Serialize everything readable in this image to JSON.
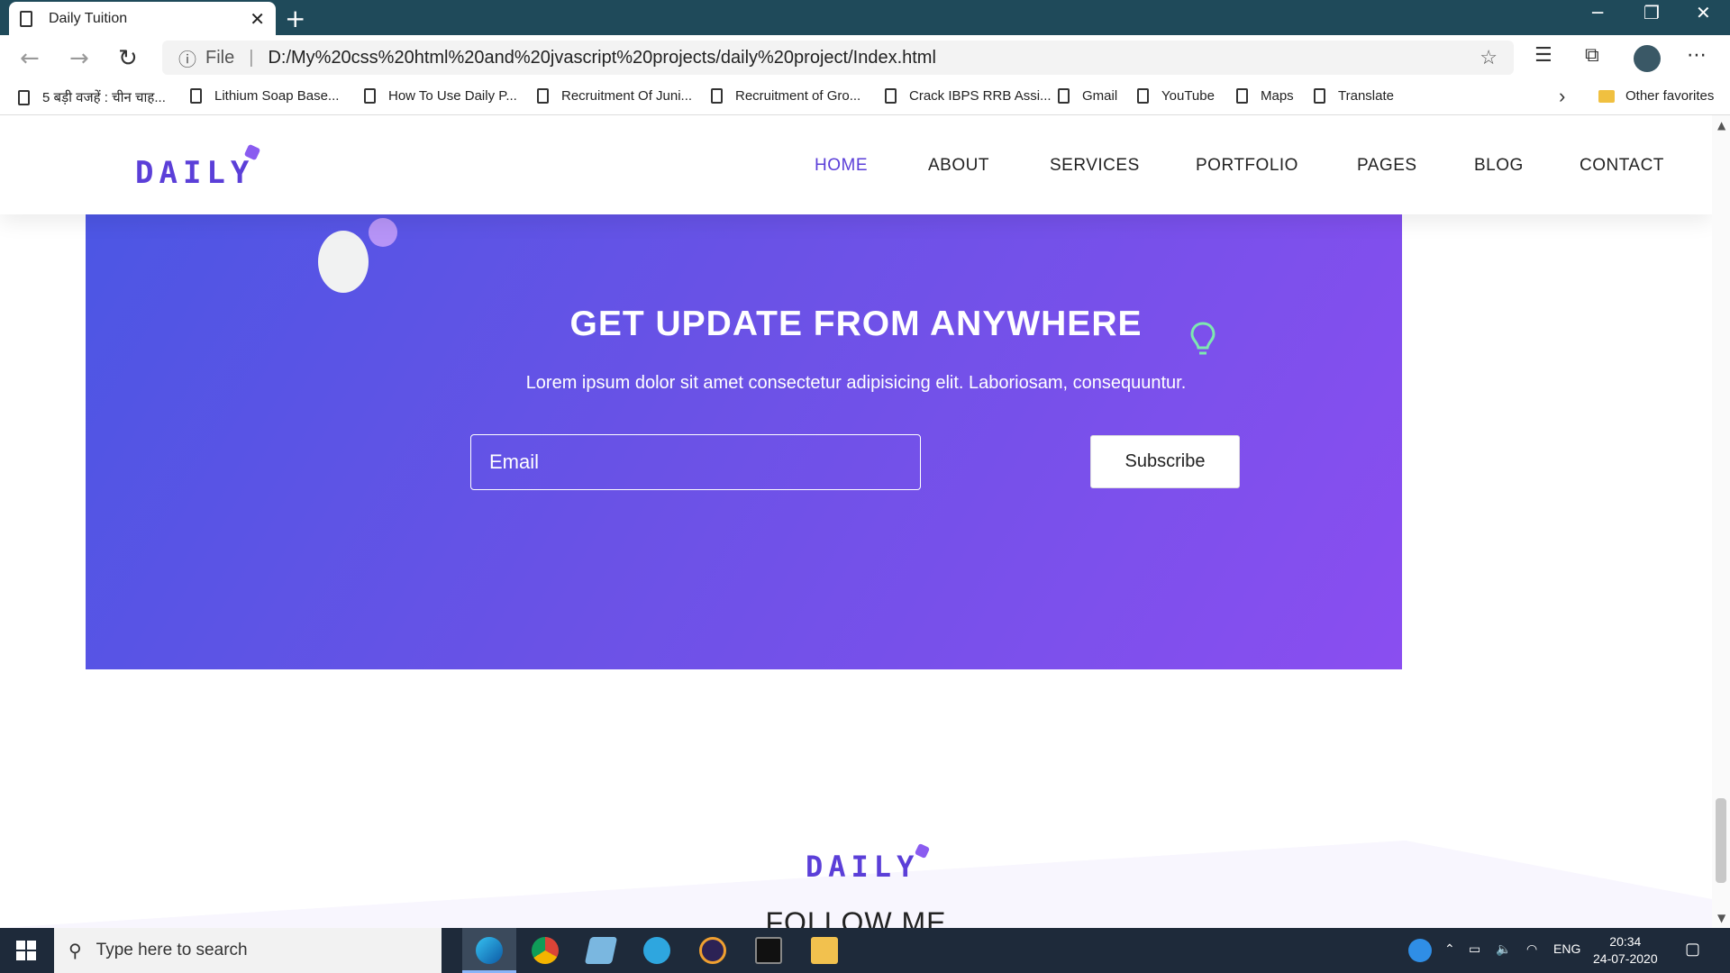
{
  "browser": {
    "tab_title": "Daily Tuition",
    "tab_close": "✕",
    "new_tab": "+",
    "url_info": "ⓘ",
    "url_scheme": "File",
    "url_sep": "|",
    "url": "D:/My%20css%20html%20and%20jvascript%20projects/daily%20project/Index.html",
    "bookmarks": [
      "5 बड़ी वजहें : चीन चाह...",
      "Lithium Soap Base...",
      "How To Use Daily P...",
      "Recruitment Of Juni...",
      "Recruitment of Gro...",
      "Crack IBPS RRB Assi...",
      "Gmail",
      "YouTube",
      "Maps",
      "Translate"
    ],
    "other_favorites": "Other favorites"
  },
  "site": {
    "logo": "DAILY",
    "nav": [
      "HOME",
      "ABOUT",
      "SERVICES",
      "PORTFOLIO",
      "PAGES",
      "BLOG",
      "CONTACT"
    ],
    "cta": {
      "title": "GET UPDATE FROM ANYWHERE",
      "subtitle": "Lorem ipsum dolor sit amet consectetur adipisicing elit. Laboriosam, consequuntur.",
      "email_placeholder": "Email",
      "button": "Subscribe"
    },
    "footer": {
      "logo": "DAILY",
      "follow": "FOLLOW ME"
    }
  },
  "taskbar": {
    "search_placeholder": "Type here to search",
    "language": "ENG",
    "time": "20:34",
    "date": "24-07-2020"
  },
  "colors": {
    "brand": "#5b3fd8",
    "cta_start": "#4c56e4",
    "cta_end": "#8a4ef0",
    "tabbar": "#1f4a5a",
    "taskbar": "#1e2a3a"
  }
}
